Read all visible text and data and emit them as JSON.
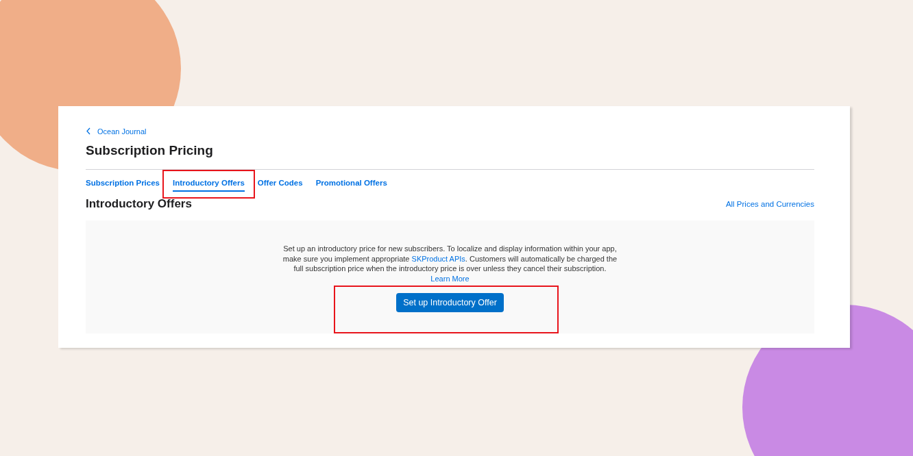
{
  "breadcrumb": {
    "label": "Ocean Journal"
  },
  "title": "Subscription Pricing",
  "tabs": [
    {
      "label": "Subscription Prices",
      "selected": false
    },
    {
      "label": "Introductory Offers",
      "selected": true
    },
    {
      "label": "Offer Codes",
      "selected": false
    },
    {
      "label": "Promotional Offers",
      "selected": false
    }
  ],
  "section": {
    "title": "Introductory Offers",
    "link": "All Prices and Currencies"
  },
  "description": [
    {
      "kind": "text",
      "text": "Set up an introductory price for new subscribers. To localize and display information within your app, make sure you implement appropriate "
    },
    {
      "kind": "link",
      "text": "SKProduct APIs"
    },
    {
      "kind": "text",
      "text": ". Customers will automatically be charged the full subscription price when the introductory price is over unless they cancel their subscription. "
    },
    {
      "kind": "link",
      "text": "Learn More"
    }
  ],
  "button": "Set up Introductory Offer"
}
